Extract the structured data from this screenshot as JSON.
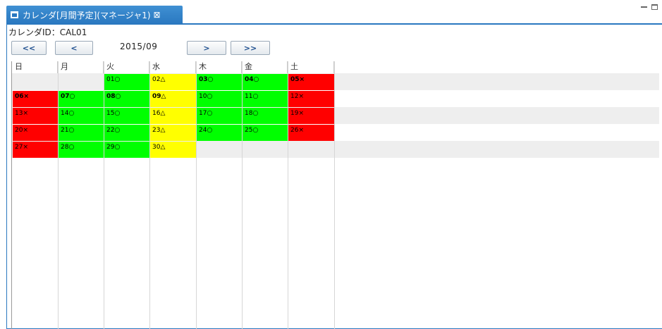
{
  "tab": {
    "title": "カレンダ[月間予定](マネージャ1)",
    "close_glyph": "⊠"
  },
  "calendar_id_label": "カレンダID：CAL01",
  "nav": {
    "first_label": "<<",
    "prev_label": "<",
    "next_label": ">",
    "last_label": ">>",
    "month": "2015/09"
  },
  "weekdays": [
    "日",
    "月",
    "火",
    "水",
    "木",
    "金",
    "土"
  ],
  "legend_colors": {
    "available": "#00ff00",
    "partial": "#ffff00",
    "unavailable": "#ff0000"
  },
  "days": [
    {
      "label": "01○",
      "status": "available",
      "bold": false
    },
    {
      "label": "02△",
      "status": "partial",
      "bold": false
    },
    {
      "label": "03○",
      "status": "available",
      "bold": true
    },
    {
      "label": "04○",
      "status": "available",
      "bold": true
    },
    {
      "label": "05×",
      "status": "unavailable",
      "bold": true
    },
    {
      "label": "06×",
      "status": "unavailable",
      "bold": true
    },
    {
      "label": "07○",
      "status": "available",
      "bold": true
    },
    {
      "label": "08○",
      "status": "available",
      "bold": true
    },
    {
      "label": "09△",
      "status": "partial",
      "bold": true
    },
    {
      "label": "10○",
      "status": "available",
      "bold": false
    },
    {
      "label": "11○",
      "status": "available",
      "bold": false
    },
    {
      "label": "12×",
      "status": "unavailable",
      "bold": false
    },
    {
      "label": "13×",
      "status": "unavailable",
      "bold": false
    },
    {
      "label": "14○",
      "status": "available",
      "bold": false
    },
    {
      "label": "15○",
      "status": "available",
      "bold": false
    },
    {
      "label": "16△",
      "status": "partial",
      "bold": false
    },
    {
      "label": "17○",
      "status": "available",
      "bold": false
    },
    {
      "label": "18○",
      "status": "available",
      "bold": false
    },
    {
      "label": "19×",
      "status": "unavailable",
      "bold": false
    },
    {
      "label": "20×",
      "status": "unavailable",
      "bold": false
    },
    {
      "label": "21○",
      "status": "available",
      "bold": false
    },
    {
      "label": "22○",
      "status": "available",
      "bold": false
    },
    {
      "label": "23△",
      "status": "partial",
      "bold": false
    },
    {
      "label": "24○",
      "status": "available",
      "bold": false
    },
    {
      "label": "25○",
      "status": "available",
      "bold": false
    },
    {
      "label": "26×",
      "status": "unavailable",
      "bold": false
    },
    {
      "label": "27×",
      "status": "unavailable",
      "bold": false
    },
    {
      "label": "28○",
      "status": "available",
      "bold": false
    },
    {
      "label": "29○",
      "status": "available",
      "bold": false
    },
    {
      "label": "30△",
      "status": "partial",
      "bold": false
    }
  ]
}
